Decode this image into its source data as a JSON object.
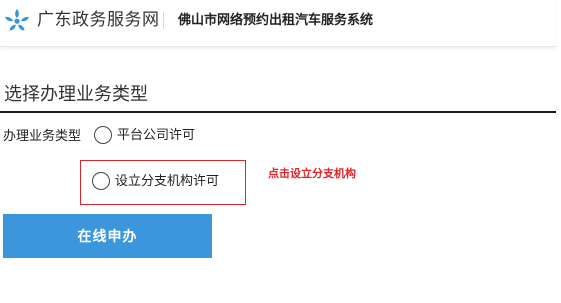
{
  "header": {
    "brand_name": "广东政务服务网",
    "system_name": "佛山市网络预约出租汽车服务系统",
    "logo_icon": "gd-gov-service-logo",
    "logo_color": "#3a95d8"
  },
  "section": {
    "title": "选择办理业务类型"
  },
  "form": {
    "business_type_label": "办理业务类型",
    "options": [
      {
        "label": "平台公司许可",
        "selected": false
      },
      {
        "label": "设立分支机构许可",
        "selected": false
      }
    ]
  },
  "annotation": {
    "text": "点击设立分支机构",
    "color": "#e0242a"
  },
  "actions": {
    "apply_label": "在线申办",
    "apply_color": "#3c96dc"
  }
}
